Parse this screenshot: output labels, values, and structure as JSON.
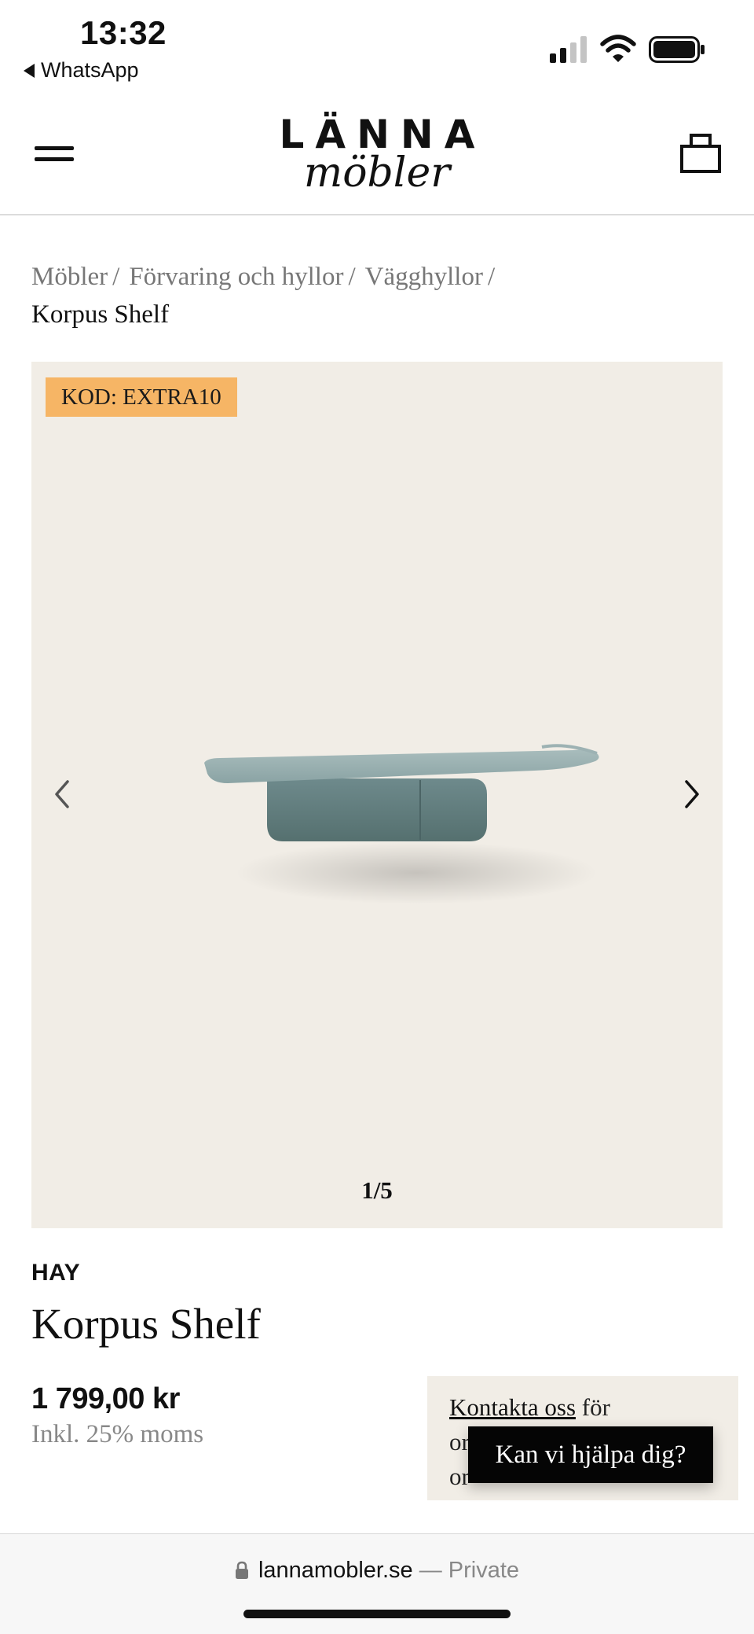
{
  "status_bar": {
    "time": "13:32",
    "back_app": "WhatsApp",
    "icons": [
      "signal-icon",
      "wifi-icon",
      "battery-icon"
    ]
  },
  "header": {
    "logo_top": "LÄNNA",
    "logo_bottom": "möbler",
    "icons": [
      "menu-icon",
      "shopping-bag-icon"
    ]
  },
  "breadcrumb": {
    "items": [
      "Möbler",
      "Förvaring och hyllor",
      "Vägghyllor"
    ],
    "separator": "/",
    "current": "Korpus Shelf"
  },
  "gallery": {
    "promo_code": "KOD: EXTRA10",
    "counter": "1/5",
    "image": "wall-shelf-product-image",
    "background_color": "#f1ede6",
    "promo_color": "#f6b565"
  },
  "product": {
    "brand": "HAY",
    "title": "Korpus Shelf",
    "price": "1 799,00 kr",
    "vat_note": "Inkl. 25% moms"
  },
  "contact": {
    "link": "Kontakta oss",
    "text_after_link": "för",
    "line2_partial": "or",
    "line3_partial": "or",
    "chat_button": "Kan vi hjälpa dig?"
  },
  "browser": {
    "domain": "lannamobler.se",
    "private_label": "— Private"
  }
}
